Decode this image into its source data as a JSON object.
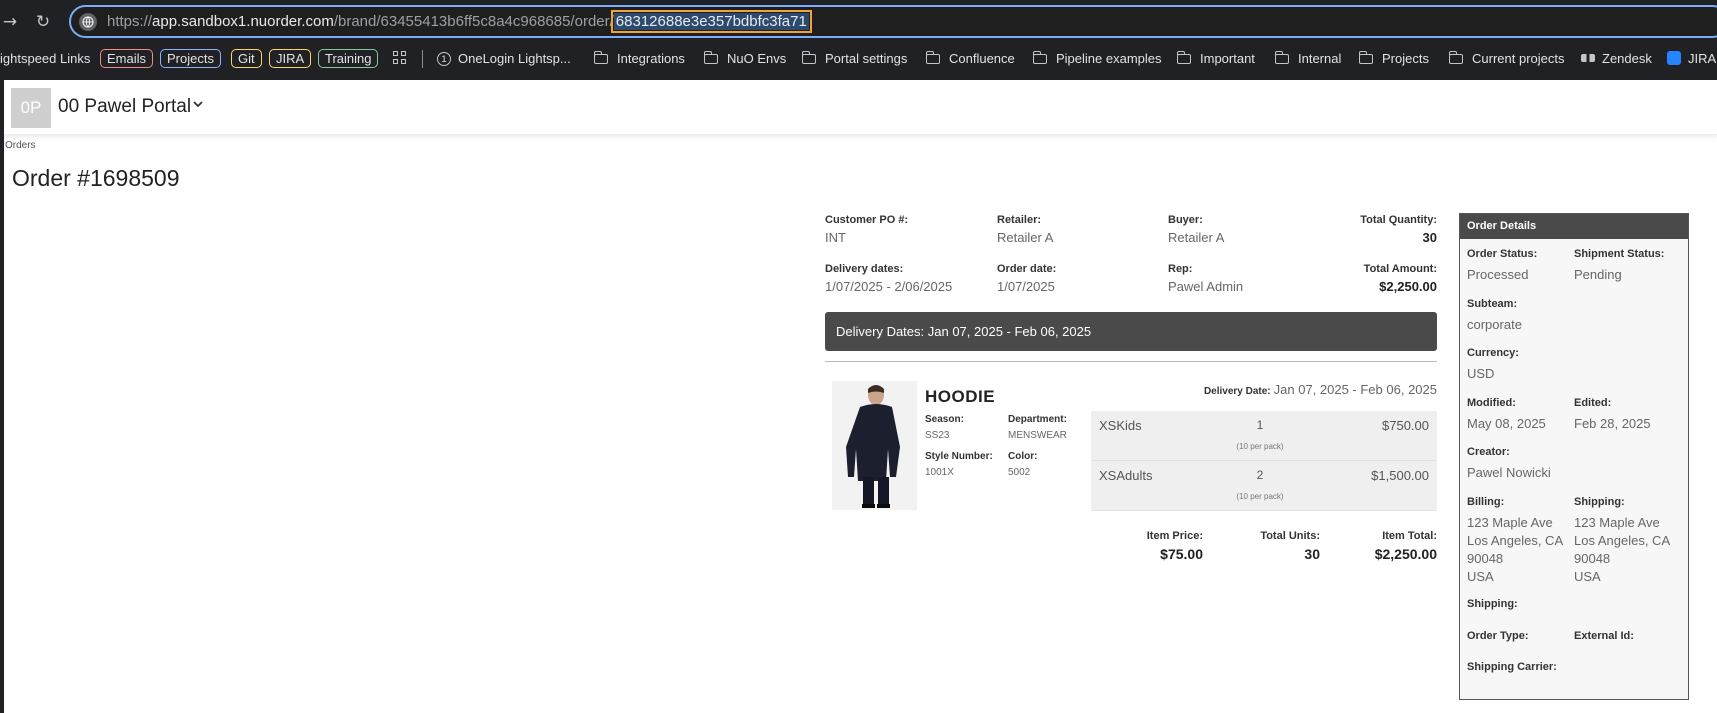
{
  "browser": {
    "url_scheme": "https://",
    "url_host": "app.sandbox1.nuorder.com",
    "url_path": "/brand/63455413b6ff5c8a4c968685/order/",
    "url_selected": "68312688e3e357bdbfc3fa71",
    "bookmarks": {
      "lightspeed_links": "ightspeed Links",
      "chips": [
        "Emails",
        "Projects",
        "Git",
        "JIRA",
        "Training"
      ],
      "onelogin": "OneLogin Lightsp...",
      "folders": [
        "Integrations",
        "NuO Envs",
        "Portal settings",
        "Confluence",
        "Pipeline examples",
        "Important",
        "Internal",
        "Projects",
        "Current projects"
      ],
      "zendesk": "Zendesk",
      "jira": "JIRA"
    }
  },
  "header": {
    "avatar_initials": "0P",
    "portal_name": "00 Pawel Portal"
  },
  "breadcrumb": "Orders",
  "order": {
    "title": "Order #1698509",
    "fields": {
      "customer_po_label": "Customer PO #:",
      "customer_po": "INT",
      "retailer_label": "Retailer:",
      "retailer": "Retailer A",
      "buyer_label": "Buyer:",
      "buyer": "Retailer A",
      "total_qty_label": "Total Quantity:",
      "total_qty": "30",
      "delivery_dates_label": "Delivery dates:",
      "delivery_dates": "1/07/2025 - 2/06/2025",
      "order_date_label": "Order date:",
      "order_date": "1/07/2025",
      "rep_label": "Rep:",
      "rep": "Pawel Admin",
      "total_amount_label": "Total Amount:",
      "total_amount": "$2,250.00"
    },
    "delivery_bar": "Delivery Dates: Jan 07, 2025 - Feb 06, 2025",
    "item": {
      "name": "HOODIE",
      "season_label": "Season:",
      "season": "SS23",
      "department_label": "Department:",
      "department": "MENSWEAR",
      "style_label": "Style Number:",
      "style": "1001X",
      "color_label": "Color:",
      "color": "5002",
      "delivery_label": "Delivery Date:",
      "delivery": "Jan 07, 2025 - Feb 06, 2025",
      "sizes": [
        {
          "name": "XSKids",
          "qty": "1",
          "pack": "(10 per pack)",
          "amount": "$750.00"
        },
        {
          "name": "XSAdults",
          "qty": "2",
          "pack": "(10 per pack)",
          "amount": "$1,500.00"
        }
      ],
      "item_price_label": "Item Price:",
      "item_price": "$75.00",
      "total_units_label": "Total Units:",
      "total_units": "30",
      "item_total_label": "Item Total:",
      "item_total": "$2,250.00"
    }
  },
  "details": {
    "title": "Order Details",
    "order_status_label": "Order Status:",
    "order_status": "Processed",
    "shipment_status_label": "Shipment Status:",
    "shipment_status": "Pending",
    "subteam_label": "Subteam:",
    "subteam": "corporate",
    "currency_label": "Currency:",
    "currency": "USD",
    "modified_label": "Modified:",
    "modified": "May 08, 2025",
    "edited_label": "Edited:",
    "edited": "Feb 28, 2025",
    "creator_label": "Creator:",
    "creator": "Pawel Nowicki",
    "billing_label": "Billing:",
    "billing": [
      "123 Maple Ave",
      "Los Angeles, CA",
      "90048",
      "USA"
    ],
    "shipping_label": "Shipping:",
    "shipping": [
      "123 Maple Ave",
      "Los Angeles, CA",
      "90048",
      "USA"
    ],
    "shipping2_label": "Shipping:",
    "order_type_label": "Order Type:",
    "external_id_label": "External Id:",
    "carrier_label": "Shipping Carrier:"
  },
  "colors": {
    "chrome_bg": "#202124",
    "dark_bar": "#4a4a4a",
    "chip_emails": "#f28b82",
    "chip_projects": "#8ab4f8",
    "chip_git": "#fdd663",
    "chip_jira": "#fdd663",
    "chip_training": "#81c995"
  }
}
